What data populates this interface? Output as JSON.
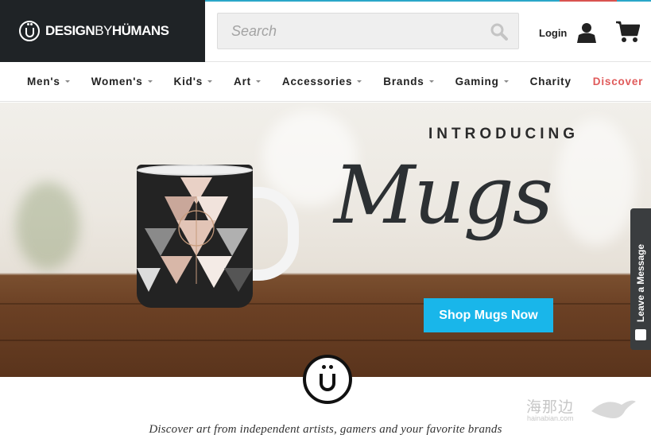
{
  "header": {
    "logo_text_bold": "DESIGN",
    "logo_text_thin": "BY",
    "logo_text_bold2": "HÜMANS",
    "search": {
      "placeholder": "Search"
    },
    "login_label": "Login"
  },
  "nav": {
    "items": [
      {
        "label": "Men's",
        "caret": true
      },
      {
        "label": "Women's",
        "caret": true
      },
      {
        "label": "Kid's",
        "caret": true
      },
      {
        "label": "Art",
        "caret": true
      },
      {
        "label": "Accessories",
        "caret": true
      },
      {
        "label": "Brands",
        "caret": true
      },
      {
        "label": "Gaming",
        "caret": true
      },
      {
        "label": "Charity",
        "caret": false
      },
      {
        "label": "Discover",
        "caret": false
      }
    ]
  },
  "hero": {
    "eyebrow": "INTRODUCING",
    "title": "Mugs",
    "cta_label": "Shop Mugs Now"
  },
  "chat_tab": {
    "label": "Leave a Message"
  },
  "tagline": "Discover art from independent artists, gamers and your favorite brands",
  "watermark": {
    "text": "海那边",
    "url": "hainabian.com"
  },
  "colors": {
    "accent": "#19b6ea",
    "discover": "#e05a5a",
    "logo_bg": "#1f2326"
  },
  "icons": [
    "search-icon",
    "user-icon",
    "cart-icon",
    "message-icon"
  ]
}
